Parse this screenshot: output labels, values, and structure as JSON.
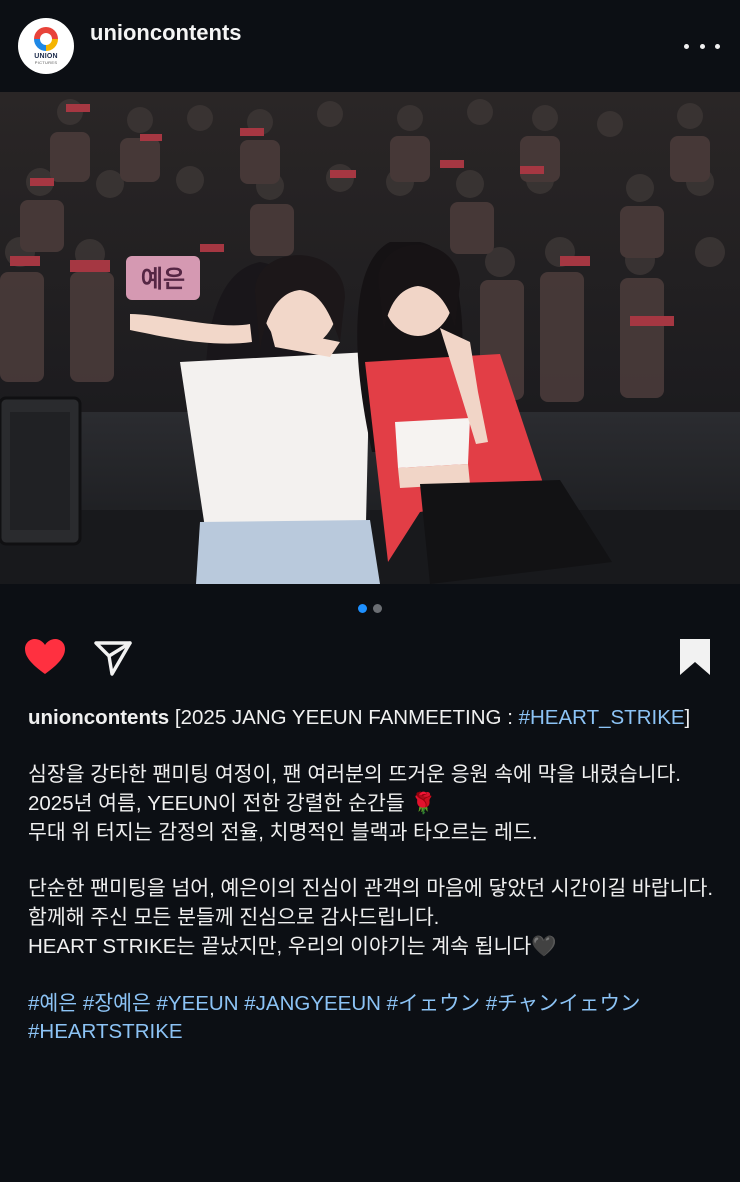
{
  "post": {
    "username": "unioncontents",
    "avatar": {
      "brand": "UNION",
      "brand_sub": "PICTURES"
    },
    "more_label": "More options"
  },
  "media": {
    "banner_text": "예은",
    "dots": [
      {
        "active": true
      },
      {
        "active": false
      }
    ]
  },
  "actions": {
    "like_icon": "heart-icon",
    "share_icon": "send-icon",
    "save_icon": "bookmark-icon",
    "like_color": "#ff3040"
  },
  "caption": {
    "author": "unioncontents",
    "title_text": " [2025 JANG YEEUN FANMEETING : ",
    "title_tag": "#HEART_STRIKE",
    "title_close": "]",
    "line1": "심장을 강타한 팬미팅 여정이, 팬 여러분의 뜨거운 응원 속에 막을 내렸습니다.",
    "line2": "2025년 여름, YEEUN이 전한 강렬한 순간들",
    "line2_emoji": "🌹",
    "line3": "무대 위 터지는 감정의 전율, 치명적인 블랙과 타오르는 레드.",
    "line4": "단순한 팬미팅을 넘어, 예은이의 진심이 관객의 마음에 닿았던 시간이길 바랍니다.",
    "line5": "함께해 주신 모든 분들께 진심으로 감사드립니다.",
    "line6": "HEART STRIKE는 끝났지만, 우리의 이야기는 계속 됩니다",
    "line6_emoji": "🖤",
    "hashtags": [
      "#예은",
      "#장예은",
      "#YEEUN",
      "#JANGYEEUN",
      "#イェウン",
      "#チャンイェウン",
      "#HEARTSTRIKE"
    ]
  },
  "colors": {
    "background": "#0c0f14",
    "hashtag": "#8cc3f5",
    "dot_active": "#1e90ff"
  }
}
